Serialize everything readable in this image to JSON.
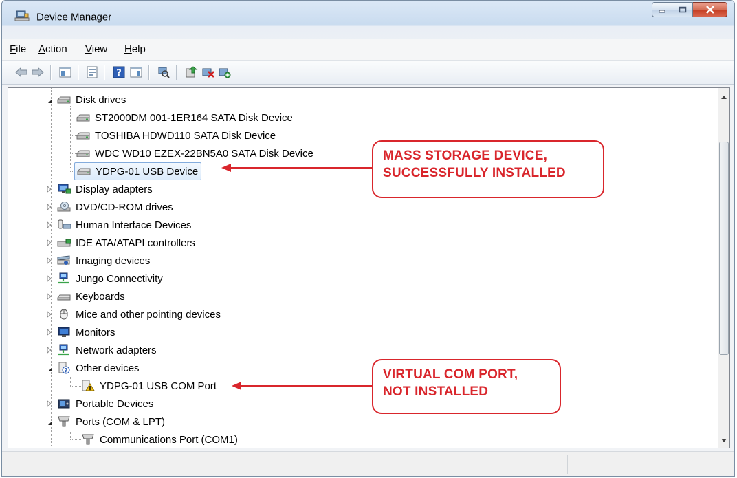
{
  "window": {
    "title": "Device Manager",
    "icons": {
      "title": "computer-management-icon",
      "minimize": "minimize-icon",
      "maximize": "maximize-icon",
      "close": "close-icon"
    }
  },
  "menu": {
    "items": [
      {
        "key": "F",
        "rest": "ile"
      },
      {
        "key": "A",
        "rest": "ction"
      },
      {
        "key": "V",
        "rest": "iew"
      },
      {
        "key": "H",
        "rest": "elp"
      }
    ]
  },
  "toolbar": {
    "icons": [
      "back-arrow-icon",
      "forward-arrow-icon",
      "show-hide-console-tree-icon",
      "properties-icon",
      "help-icon",
      "action-pane-icon",
      "scan-hardware-icon",
      "update-driver-icon",
      "disable-device-icon",
      "uninstall-device-icon"
    ]
  },
  "tree": {
    "disk_drives": {
      "label": "Disk drives",
      "children": [
        "ST2000DM 001-1ER164 SATA Disk Device",
        "TOSHIBA HDWD110 SATA Disk Device",
        "WDC WD10 EZEX-22BN5A0 SATA Disk Device",
        "YDPG-01 USB Device"
      ]
    },
    "categories": [
      "Display adapters",
      "DVD/CD-ROM drives",
      "Human Interface Devices",
      "IDE ATA/ATAPI controllers",
      "Imaging devices",
      "Jungo Connectivity",
      "Keyboards",
      "Mice and other pointing devices",
      "Monitors",
      "Network adapters"
    ],
    "other_devices": {
      "label": "Other devices",
      "children": [
        "YDPG-01 USB COM Port"
      ]
    },
    "portable_devices": "Portable Devices",
    "ports": {
      "label": "Ports (COM & LPT)",
      "children": [
        "Communications Port (COM1)"
      ]
    }
  },
  "annotations": {
    "mass_storage": [
      "MASS STORAGE DEVICE,",
      "SUCCESSFULLY INSTALLED"
    ],
    "com_port": [
      "VIRTUAL COM PORT,",
      "NOT INSTALLED"
    ],
    "color": "#d9262c"
  },
  "colors": {
    "selection_border": "#84acdd",
    "accent": "#d9262c"
  }
}
